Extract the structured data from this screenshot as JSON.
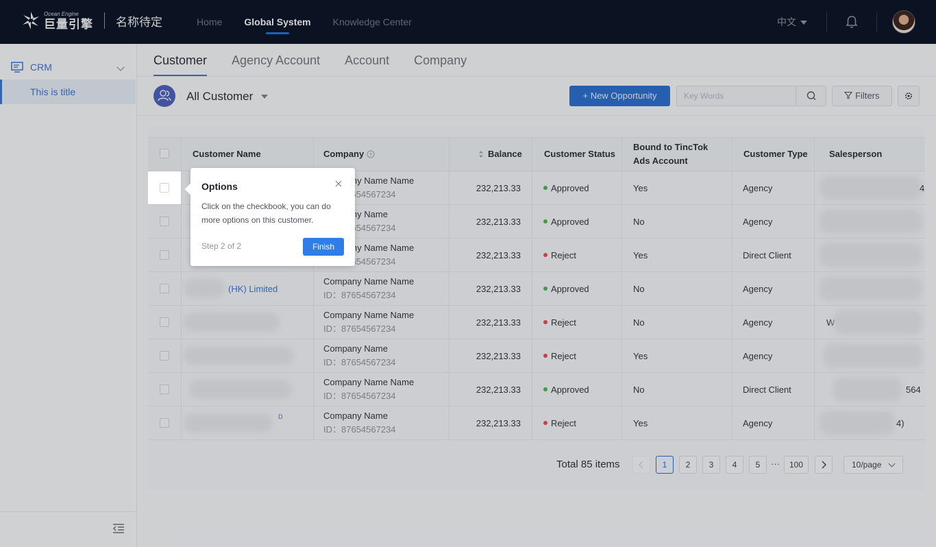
{
  "header": {
    "logo_small": "Ocean Engine",
    "logo_main": "巨量引擎",
    "app_name": "名称待定",
    "nav": [
      {
        "label": "Home"
      },
      {
        "label": "Global System",
        "active": true
      },
      {
        "label": "Knowledge Center"
      }
    ],
    "language": "中文"
  },
  "sidebar": {
    "menu_label": "CRM",
    "sub_item": "This is title"
  },
  "tabs": [
    "Customer",
    "Agency Account",
    "Account",
    "Company"
  ],
  "toolbar": {
    "view_title": "All Customer",
    "new_button": "+ New Opportunity",
    "search_placeholder": "Key Words",
    "filters_label": "Filters"
  },
  "table": {
    "columns": {
      "customer_name": "Customer Name",
      "company": "Company",
      "balance": "Balance",
      "status": "Customer Status",
      "bound": "Bound to TincTok Ads Account",
      "type": "Customer Type",
      "salesperson": "Salesperson"
    },
    "rows": [
      {
        "name": "",
        "company": "Company Name Name",
        "company_id": "ID：87654567234",
        "balance": "232,213.33",
        "status": "Approved",
        "bound": "Yes",
        "type": "Agency",
        "sales": "4"
      },
      {
        "name": "",
        "company": "Company Name",
        "company_id": "ID：87654567234",
        "balance": "232,213.33",
        "status": "Approved",
        "bound": "No",
        "type": "Agency",
        "sales": ""
      },
      {
        "name": "",
        "company": "Company Name Name",
        "company_id": "ID：87654567234",
        "balance": "232,213.33",
        "status": "Reject",
        "bound": "Yes",
        "type": "Direct Client",
        "sales": ""
      },
      {
        "name": "(HK) Limited",
        "company": "Company Name Name",
        "company_id": "ID：87654567234",
        "balance": "232,213.33",
        "status": "Approved",
        "bound": "No",
        "type": "Agency",
        "sales": ""
      },
      {
        "name": "",
        "company": "Company Name Name",
        "company_id": "ID：87654567234",
        "balance": "232,213.33",
        "status": "Reject",
        "bound": "No",
        "type": "Agency",
        "sales": "W"
      },
      {
        "name": "",
        "company": "Company Name",
        "company_id": "ID：87654567234",
        "balance": "232,213.33",
        "status": "Reject",
        "bound": "Yes",
        "type": "Agency",
        "sales": ""
      },
      {
        "name": "",
        "company": "Company Name Name",
        "company_id": "ID：87654567234",
        "balance": "232,213.33",
        "status": "Approved",
        "bound": "No",
        "type": "Direct Client",
        "sales": "564"
      },
      {
        "name": "D",
        "company": "Company Name",
        "company_id": "ID：87654567234",
        "balance": "232,213.33",
        "status": "Reject",
        "bound": "Yes",
        "type": "Agency",
        "sales": "4)"
      }
    ]
  },
  "pagination": {
    "total": "Total 85 items",
    "pages": [
      "1",
      "2",
      "3",
      "4",
      "5"
    ],
    "ellipsis": "···",
    "last": "100",
    "page_size": "10/page"
  },
  "guide": {
    "title": "Options",
    "body": "Click on the checkbook, you can do more options on this customer.",
    "step": "Step 2 of 2",
    "finish": "Finish"
  },
  "colors": {
    "topbar": "#0d1526",
    "primary": "#2c6bc9",
    "approved": "#4caf50",
    "reject": "#e5484d"
  }
}
